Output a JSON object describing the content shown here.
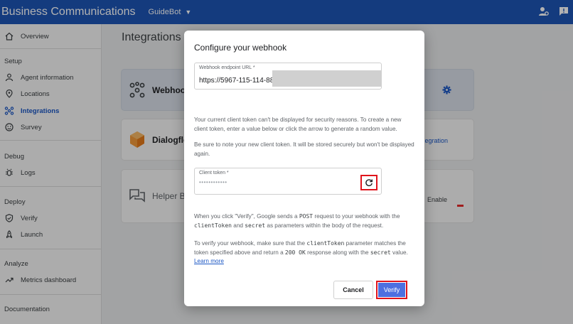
{
  "header": {
    "app_title": "Business Communications",
    "agent_name": "GuideBot",
    "brand_color": "#1d55b5"
  },
  "sidebar": {
    "overview": "Overview",
    "setup_title": "Setup",
    "setup_items": [
      "Agent information",
      "Locations",
      "Integrations",
      "Survey"
    ],
    "debug_title": "Debug",
    "debug_items": [
      "Logs"
    ],
    "deploy_title": "Deploy",
    "deploy_items": [
      "Verify",
      "Launch"
    ],
    "analyze_title": "Analyze",
    "analyze_items": [
      "Metrics dashboard"
    ],
    "documentation_title": "Documentation"
  },
  "main": {
    "page_title": "Integrations",
    "cards": {
      "webhook": "Webhook",
      "dialogflow": "Dialogflow",
      "dialogflow_link": "egration",
      "helper": "Helper Bo",
      "helper_action": "Enable"
    }
  },
  "dialog": {
    "title": "Configure your webhook",
    "url_label": "Webhook endpoint URL *",
    "url_value": "https://5967-115-114-88",
    "info_1": "Your current client token can't be displayed for security reasons. To create a new client token, enter a value below or click the arrow to generate a random value.",
    "info_2": "Be sure to note your new client token. It will be stored securely but won't be displayed again.",
    "token_label": "Client token *",
    "token_value": "••••••••••••",
    "verify_para": {
      "t1": "When you click \"Verify\", Google sends a ",
      "c1": "POST",
      "t2": " request to your webhook with the ",
      "c2": "clientToken",
      "t3": " and ",
      "c3": "secret",
      "t4": " as parameters within the body of the request."
    },
    "match_para": {
      "t1": "To verify your webhook, make sure that the ",
      "c1": "clientToken",
      "t2": " parameter matches the token specified above and return a ",
      "c2": "200 OK",
      "t3": " response along with the ",
      "c3": "secret",
      "t4": " value. ",
      "link": "Learn more"
    },
    "cancel_label": "Cancel",
    "verify_label": "Verify"
  }
}
